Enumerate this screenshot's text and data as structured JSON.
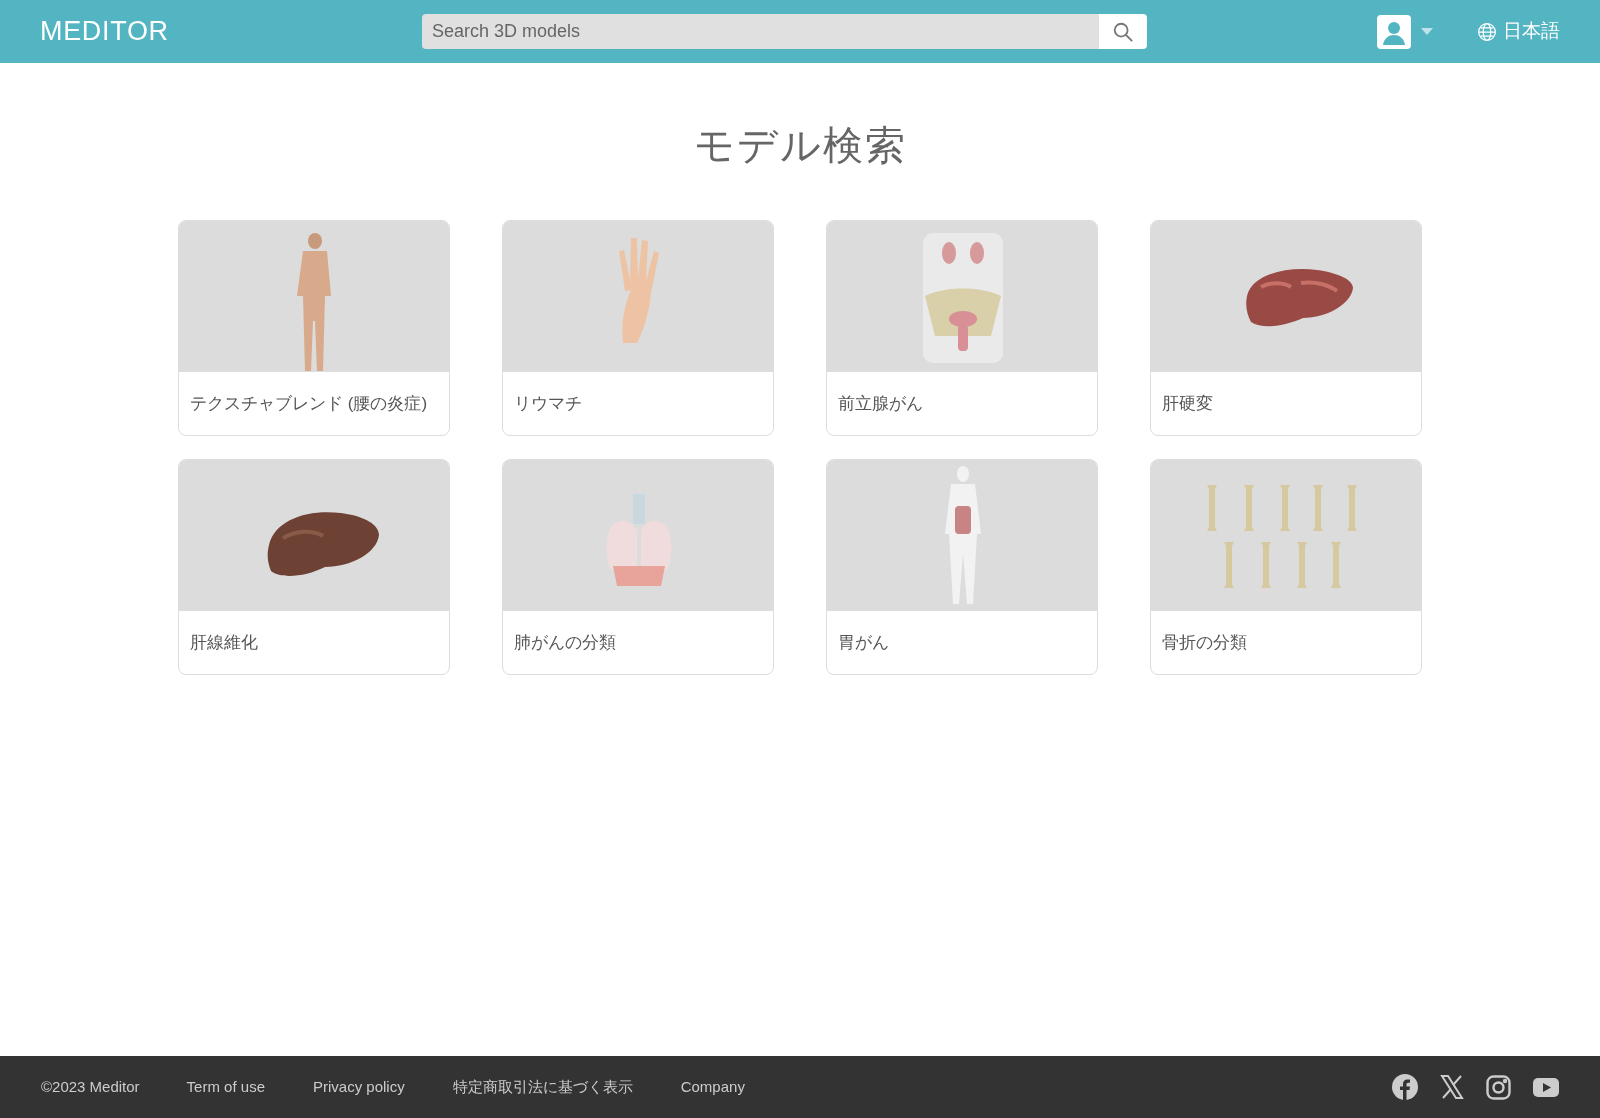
{
  "header": {
    "logo": "MEDITOR",
    "search": {
      "placeholder": "Search 3D models"
    },
    "language": "日本語"
  },
  "page_title": "モデル検索",
  "cards": [
    {
      "title": "テクスチャブレンド (腰の炎症)",
      "kind": "picture"
    },
    {
      "title": "リウマチ",
      "kind": "picture"
    },
    {
      "title": "前立腺がん",
      "kind": "picture"
    },
    {
      "title": "肝硬変",
      "kind": "picture"
    },
    {
      "title": "肝線維化",
      "kind": "picture"
    },
    {
      "title": "肺がんの分類",
      "kind": "picture"
    },
    {
      "title": "胃がん",
      "kind": "picture"
    },
    {
      "title": "骨折の分類",
      "kind": "picture"
    }
  ],
  "footer": {
    "copyright": "©2023 Meditor",
    "links": [
      "Term of use",
      "Privacy policy",
      "特定商取引法に基づく表示",
      "Company"
    ]
  }
}
